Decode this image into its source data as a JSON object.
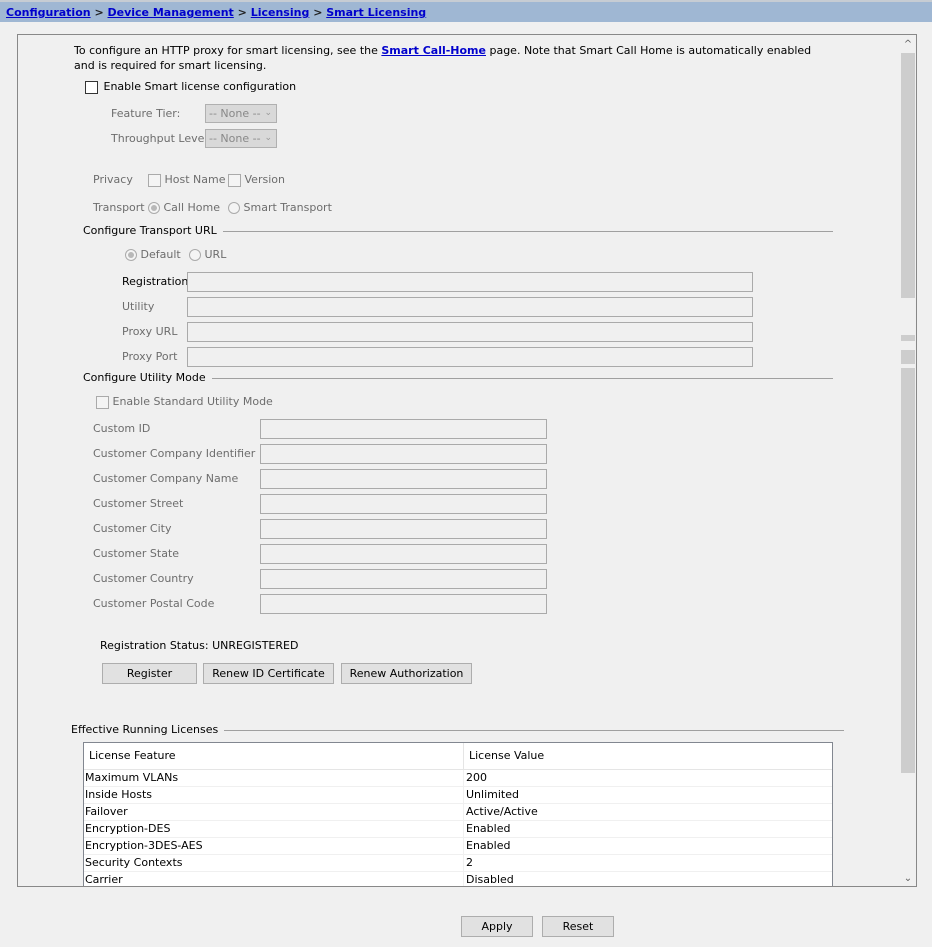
{
  "breadcrumb": {
    "items": [
      "Configuration",
      "Device Management",
      "Licensing",
      "Smart Licensing"
    ],
    "separator": ">"
  },
  "intro": {
    "text_before": "To configure an HTTP proxy for smart licensing, see the ",
    "link": "Smart Call-Home",
    "text_after": " page. Note that Smart Call Home is automatically enabled and is required for smart licensing."
  },
  "enable_smart": {
    "label": "Enable Smart license configuration",
    "checked": false
  },
  "feature_tier": {
    "label": "Feature Tier:",
    "value": "-- None --"
  },
  "throughput_level": {
    "label": "Throughput Level:",
    "value": "-- None --"
  },
  "privacy": {
    "label": "Privacy",
    "host_name": "Host Name",
    "version": "Version"
  },
  "transport": {
    "label": "Transport",
    "call_home": "Call Home",
    "smart_transport": "Smart Transport",
    "selected": "Call Home"
  },
  "transport_url": {
    "title": "Configure Transport URL",
    "default": "Default",
    "url": "URL",
    "selected": "Default",
    "fields": [
      {
        "label": "Registration",
        "value": ""
      },
      {
        "label": "Utility",
        "value": ""
      },
      {
        "label": "Proxy URL",
        "value": ""
      },
      {
        "label": "Proxy Port",
        "value": ""
      }
    ]
  },
  "utility_mode": {
    "title": "Configure Utility Mode",
    "enable_label": "Enable Standard Utility Mode",
    "fields": [
      {
        "label": "Custom ID",
        "value": ""
      },
      {
        "label": "Customer Company Identifier",
        "value": ""
      },
      {
        "label": "Customer Company Name",
        "value": ""
      },
      {
        "label": "Customer Street",
        "value": ""
      },
      {
        "label": "Customer City",
        "value": ""
      },
      {
        "label": "Customer State",
        "value": ""
      },
      {
        "label": "Customer Country",
        "value": ""
      },
      {
        "label": "Customer Postal Code",
        "value": ""
      }
    ]
  },
  "registration": {
    "status_label": "Registration Status:",
    "status_value": "UNREGISTERED",
    "buttons": [
      "Register",
      "Renew ID Certificate",
      "Renew Authorization"
    ]
  },
  "licenses": {
    "title": "Effective Running Licenses",
    "columns": [
      "License Feature",
      "License Value"
    ],
    "rows": [
      [
        "Maximum VLANs",
        "200"
      ],
      [
        "Inside Hosts",
        "Unlimited"
      ],
      [
        "Failover",
        "Active/Active"
      ],
      [
        "Encryption-DES",
        "Enabled"
      ],
      [
        "Encryption-3DES-AES",
        "Enabled"
      ],
      [
        "Security Contexts",
        "2"
      ],
      [
        "Carrier",
        "Disabled"
      ]
    ]
  },
  "footer": {
    "apply": "Apply",
    "reset": "Reset"
  },
  "icons": {
    "scroll_up": "chevron-up-icon",
    "scroll_down": "chevron-down-icon",
    "combo": "chevron-down-icon"
  }
}
